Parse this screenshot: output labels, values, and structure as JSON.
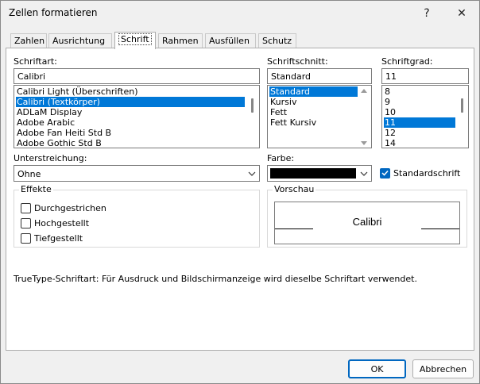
{
  "window": {
    "title": "Zellen formatieren",
    "help_glyph": "?",
    "close_glyph": "✕"
  },
  "tabs": [
    {
      "label": "Zahlen",
      "active": false
    },
    {
      "label": "Ausrichtung",
      "active": false
    },
    {
      "label": "Schrift",
      "active": true
    },
    {
      "label": "Rahmen",
      "active": false
    },
    {
      "label": "Ausfüllen",
      "active": false
    },
    {
      "label": "Schutz",
      "active": false
    }
  ],
  "font": {
    "label": "Schriftart:",
    "value": "Calibri",
    "items": [
      "Calibri Light (Überschriften)",
      "Calibri (Textkörper)",
      "ADLaM Display",
      "Adobe Arabic",
      "Adobe Fan Heiti Std B",
      "Adobe Gothic Std B"
    ],
    "selected_index": 1
  },
  "style": {
    "label": "Schriftschnitt:",
    "value": "Standard",
    "items": [
      "Standard",
      "Kursiv",
      "Fett",
      "Fett Kursiv"
    ],
    "selected_index": 0
  },
  "size": {
    "label": "Schriftgrad:",
    "value": "11",
    "items": [
      "8",
      "9",
      "10",
      "11",
      "12",
      "14"
    ],
    "selected_index": 3
  },
  "underline": {
    "label": "Unterstreichung:",
    "value": "Ohne"
  },
  "color": {
    "label": "Farbe:",
    "swatch": "#000000"
  },
  "standard_font": {
    "label": "Standardschrift",
    "checked": true
  },
  "effects": {
    "title": "Effekte",
    "items": [
      {
        "label": "Durchgestrichen",
        "checked": false
      },
      {
        "label": "Hochgestellt",
        "checked": false
      },
      {
        "label": "Tiefgestellt",
        "checked": false
      }
    ]
  },
  "preview": {
    "title": "Vorschau",
    "sample": "Calibri"
  },
  "info": "TrueType-Schriftart: Für Ausdruck und Bildschirmanzeige wird dieselbe Schriftart verwendet.",
  "buttons": {
    "ok": "OK",
    "cancel": "Abbrechen"
  },
  "colors": {
    "selection": "#0078d7",
    "checkbox": "#0067c0",
    "default_button_border": "#0067c0"
  }
}
